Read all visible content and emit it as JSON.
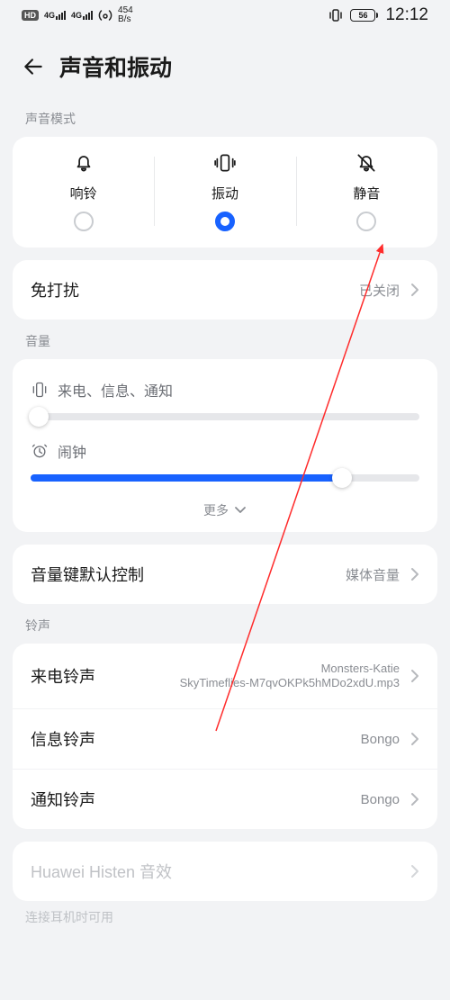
{
  "status": {
    "hd_badge": "HD",
    "net_sup": "4G",
    "speed_top": "454",
    "speed_bot": "B/s",
    "battery": "56",
    "time": "12:12"
  },
  "header": {
    "title": "声音和振动"
  },
  "mode_section": {
    "label": "声音模式",
    "ring": "响铃",
    "vibrate": "振动",
    "silent": "静音"
  },
  "dnd": {
    "label": "免打扰",
    "value": "已关闭"
  },
  "volume_section": {
    "label": "音量",
    "calls": "来电、信息、通知",
    "alarm": "闹钟",
    "more": "更多"
  },
  "vol_key": {
    "label": "音量键默认控制",
    "value": "媒体音量"
  },
  "ringtone_section": {
    "label": "铃声",
    "incoming_label": "来电铃声",
    "incoming_value": "Monsters-Katie\nSkyTimeflies-M7qvOKPk5hMDo2xdU.mp3",
    "message_label": "信息铃声",
    "message_value": "Bongo",
    "notify_label": "通知铃声",
    "notify_value": "Bongo"
  },
  "histen": {
    "label": "Huawei Histen 音效"
  },
  "headphone_label": "连接耳机时可用"
}
